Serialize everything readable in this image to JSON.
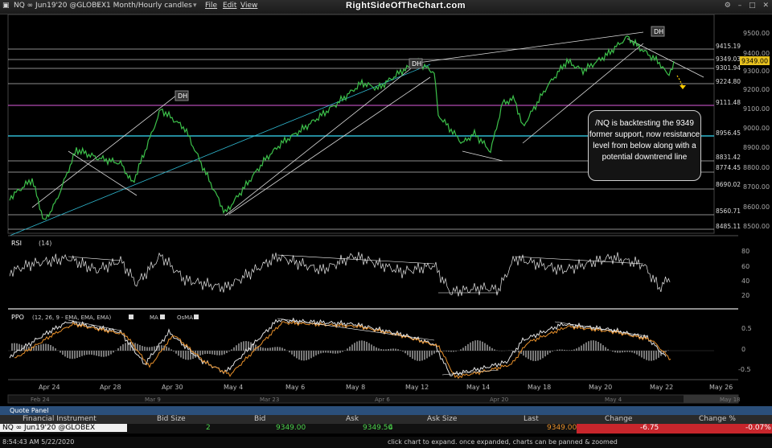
{
  "window": {
    "symbol": "NQ ∞ Jun19'20 @GLOBEX",
    "interval": "1 Month/Hourly candles",
    "menu": [
      "File",
      "Edit",
      "View"
    ],
    "brand": "RightSideOfTheChart.com"
  },
  "price_axis": {
    "ticks": [
      "9500.00",
      "9400.00",
      "9300.00",
      "9200.00",
      "9100.00",
      "9000.00",
      "8900.00",
      "8800.00",
      "8700.00",
      "8600.00",
      "8500.00"
    ],
    "levels": [
      "9415.19",
      "9349.03",
      "9301.94",
      "9224.80",
      "9111.48",
      "8956.45",
      "8831.42",
      "8774.45",
      "8690.02",
      "8560.71",
      "8485.11"
    ],
    "current": "9349.00"
  },
  "labels": {
    "dh": "DH"
  },
  "annotation": "/NQ is backtesting the 9349 former support, now resistance level from below along with a potential downtrend line",
  "rsi": {
    "name": "RSI",
    "params": "(14)",
    "ticks": [
      "80",
      "60",
      "40",
      "20"
    ]
  },
  "ppo": {
    "name": "PPO",
    "params": "(12, 26, 9 - EMA, EMA, EMA)",
    "ma": "MA",
    "osma": "OsMA",
    "ticks": [
      "0.5",
      "0",
      "-0.5"
    ]
  },
  "time_axis": {
    "major": [
      "Apr 24",
      "Apr 28",
      "Apr 30",
      "May 4",
      "May 6",
      "May 8",
      "May 12",
      "May 14",
      "May 18",
      "May 20",
      "May 22",
      "May 26"
    ],
    "navigator": [
      "Feb 24",
      "Mar 9",
      "Mar 23",
      "Apr 6",
      "Apr 20",
      "May 4",
      "May 18"
    ]
  },
  "quote_panel": {
    "title": "Quote Panel",
    "columns": [
      "Financial Instrument",
      "Bid Size",
      "Bid",
      "Ask",
      "Ask Size",
      "Last",
      "Change",
      "Change %"
    ],
    "row": {
      "instrument": "NQ ∞ Jun19'20 @GLOBEX",
      "bid_size": "2",
      "bid": "9349.00",
      "ask": "9349.50",
      "ask_size": "4",
      "last": "9349.00",
      "change": "-6.75",
      "change_pct": "-0.07%"
    }
  },
  "status": {
    "time": "8:54:43 AM 5/22/2020",
    "hint": "click chart to expand. once expanded, charts can be panned & zoomed"
  }
}
